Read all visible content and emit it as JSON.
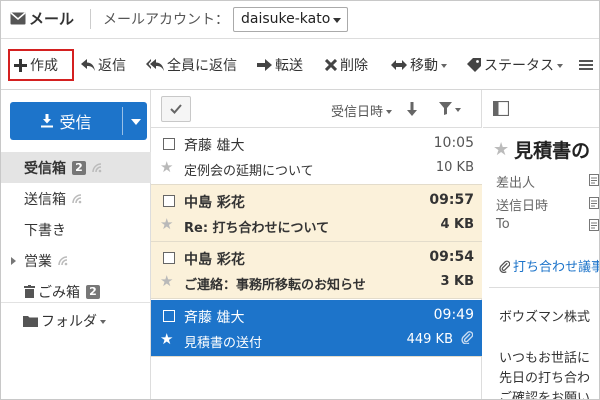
{
  "header": {
    "app_title": "メール",
    "account_label": "メールアカウント：",
    "account_value": "daisuke-kato"
  },
  "toolbar": {
    "compose": "作成",
    "reply": "返信",
    "reply_all": "全員に返信",
    "forward": "転送",
    "delete": "削除",
    "move": "移動",
    "status": "ステータス"
  },
  "sidebar": {
    "receive_button": "受信",
    "folders": [
      {
        "label": "受信箱",
        "badge": "2"
      },
      {
        "label": "送信箱"
      },
      {
        "label": "下書き"
      },
      {
        "label": "営業"
      },
      {
        "label": "ごみ箱",
        "badge": "2"
      }
    ],
    "folder_menu": "フォルダ"
  },
  "list": {
    "sort_label": "受信日時",
    "messages": [
      {
        "from": "斉藤 雄大",
        "time": "10:05",
        "subject": "定例会の延期について",
        "size": "10 KB",
        "state": "read"
      },
      {
        "from": "中島 彩花",
        "time": "09:57",
        "subject": "Re: 打ち合わせについて",
        "size": "4 KB",
        "state": "unread"
      },
      {
        "from": "中島 彩花",
        "time": "09:54",
        "subject": "ご連絡：事務所移転のお知らせ",
        "size": "3 KB",
        "state": "unread"
      },
      {
        "from": "斉藤 雄大",
        "time": "09:49",
        "subject": "見積書の送付",
        "size": "449 KB",
        "state": "selected",
        "attachment": true
      }
    ]
  },
  "preview": {
    "title": "見積書の",
    "meta_labels": [
      "差出人",
      "送信日時",
      "To"
    ],
    "attachment": "打ち合わせ議事",
    "body": [
      "ボウズマン株式",
      "いつもお世話に",
      "先日の打ち合わ",
      "ご確認をお願い"
    ]
  },
  "colors": {
    "accent": "#1d74ca",
    "unread_bg": "#fbf1da",
    "compose_highlight": "#d42020"
  }
}
